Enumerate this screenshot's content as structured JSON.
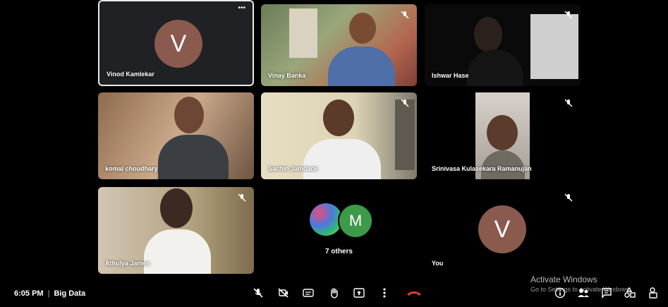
{
  "participants": {
    "vinod": {
      "name": "Vinod Kamlekar",
      "initial": "V",
      "menu": "•••"
    },
    "vinay": {
      "name": "Vinay Banka"
    },
    "ishwar": {
      "name": "Ishwar Hase"
    },
    "komal": {
      "name": "komal choudhary"
    },
    "sachin": {
      "name": "Sachin Jamdade"
    },
    "srini": {
      "name": "Srinivasa Kulasekara Ramanujan"
    },
    "athulya": {
      "name": "Athulya James"
    },
    "others": {
      "avatar_initial": "M",
      "label": "7 others"
    },
    "you": {
      "name": "You",
      "initial": "V"
    }
  },
  "bottom_bar": {
    "time": "6:05 PM",
    "separator": "|",
    "meeting_title": "Big Data"
  },
  "watermark": {
    "title": "Activate Windows",
    "subtitle": "Go to Settings to activate Windows."
  },
  "colors": {
    "avatar_bg": "#8a5a4e",
    "others_avatar_bg": "#3c9a4a",
    "end_call": "#ea4335"
  }
}
